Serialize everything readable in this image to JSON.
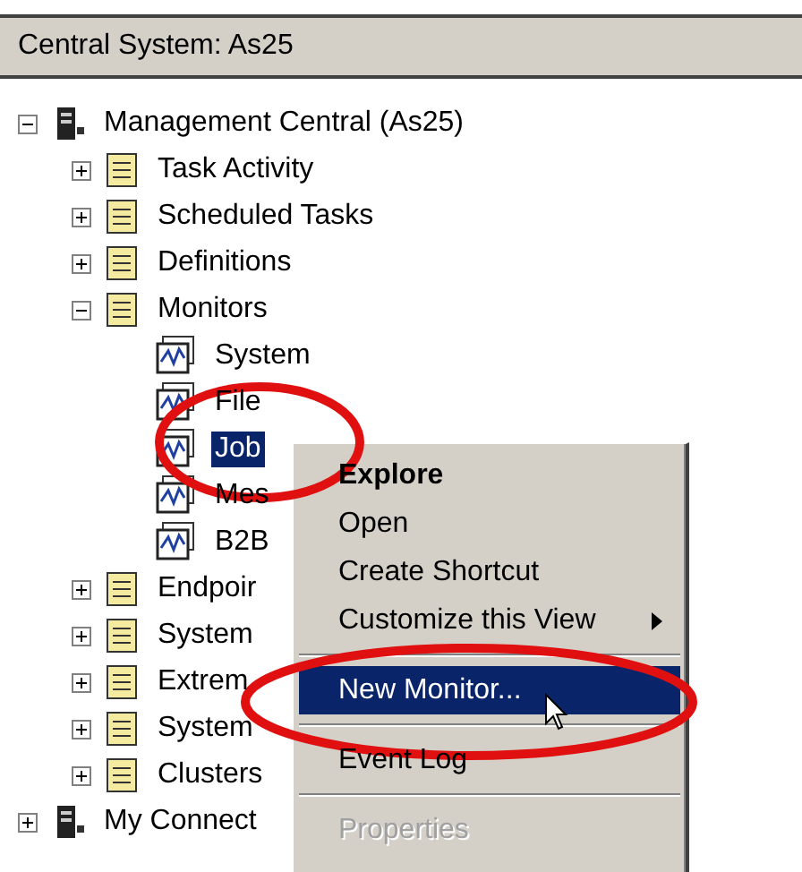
{
  "header": {
    "title": "Central System: As25"
  },
  "tree": [
    {
      "label": "Management Central (As25)",
      "expanded": true,
      "selected": false,
      "children": [
        {
          "label": "Task Activity",
          "expanded": false,
          "selected": false
        },
        {
          "label": "Scheduled Tasks",
          "expanded": false,
          "selected": false
        },
        {
          "label": "Definitions",
          "expanded": false,
          "selected": false
        },
        {
          "label": "Monitors",
          "expanded": true,
          "selected": false,
          "children": [
            {
              "label": "System",
              "selected": false
            },
            {
              "label": "File",
              "selected": false
            },
            {
              "label": "Job",
              "selected": true
            },
            {
              "label": "Mes",
              "selected": false
            },
            {
              "label": "B2B",
              "selected": false
            }
          ]
        },
        {
          "label": "Endpoir",
          "expanded": false,
          "selected": false
        },
        {
          "label": "System",
          "expanded": false,
          "selected": false
        },
        {
          "label": "Extrem",
          "expanded": false,
          "selected": false
        },
        {
          "label": "System",
          "expanded": false,
          "selected": false
        },
        {
          "label": "Clusters",
          "expanded": false,
          "selected": false
        }
      ]
    },
    {
      "label": "My Connect",
      "expanded": false,
      "selected": false
    }
  ],
  "context_menu": {
    "items": [
      {
        "kind": "item",
        "label": "Explore",
        "default": true,
        "selected": false,
        "disabled": false
      },
      {
        "kind": "item",
        "label": "Open",
        "default": false,
        "selected": false,
        "disabled": false
      },
      {
        "kind": "item",
        "label": "Create Shortcut",
        "default": false,
        "selected": false,
        "disabled": false
      },
      {
        "kind": "item",
        "label": "Customize this View",
        "default": false,
        "selected": false,
        "disabled": false,
        "submenu": true
      },
      {
        "kind": "separator"
      },
      {
        "kind": "item",
        "label": "New Monitor...",
        "default": false,
        "selected": true,
        "disabled": false
      },
      {
        "kind": "separator"
      },
      {
        "kind": "item",
        "label": "Event Log",
        "default": false,
        "selected": false,
        "disabled": false
      },
      {
        "kind": "separator"
      },
      {
        "kind": "item",
        "label": "Properties",
        "default": false,
        "selected": false,
        "disabled": true
      }
    ]
  }
}
